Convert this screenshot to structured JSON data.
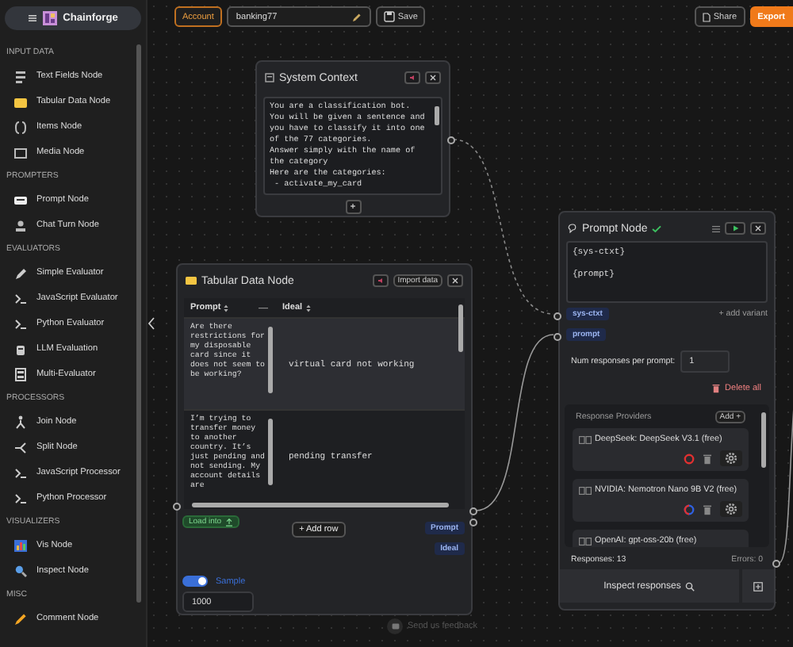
{
  "sidebar": {
    "title": "Chainforge",
    "sections": [
      {
        "title": "INPUT DATA",
        "items": [
          {
            "label": "Text Fields Node"
          },
          {
            "label": "Tabular Data Node"
          },
          {
            "label": "Items Node"
          },
          {
            "label": "Media Node"
          }
        ]
      },
      {
        "title": "PROMPTERS",
        "items": [
          {
            "label": "Prompt Node"
          },
          {
            "label": "Chat Turn Node"
          }
        ]
      },
      {
        "title": "EVALUATORS",
        "items": [
          {
            "label": "Simple Evaluator"
          },
          {
            "label": "JavaScript Evaluator"
          },
          {
            "label": "Python Evaluator"
          },
          {
            "label": "LLM Evaluation"
          },
          {
            "label": "Multi-Evaluator"
          }
        ]
      },
      {
        "title": "PROCESSORS",
        "items": [
          {
            "label": "Join Node"
          },
          {
            "label": "Split Node"
          },
          {
            "label": "JavaScript Processor"
          },
          {
            "label": "Python Processor"
          }
        ]
      },
      {
        "title": "VISUALIZERS",
        "items": [
          {
            "label": "Vis Node"
          },
          {
            "label": "Inspect Node"
          }
        ]
      },
      {
        "title": "MISC",
        "items": [
          {
            "label": "Comment Node"
          }
        ]
      }
    ]
  },
  "toolbar": {
    "account": "Account",
    "flow_name": "banking77",
    "save": "Save",
    "share": "Share",
    "export": "Export"
  },
  "system_context": {
    "title": "System Context",
    "text": "You are a classification bot.\nYou will be given a sentence and\nyou have to classify it into one\nof the 77 categories.\nAnswer simply with the name of\nthe category\nHere are the categories:\n - activate_my_card",
    "add": "+"
  },
  "tabular_node": {
    "title": "Tabular Data Node",
    "import": "Import data",
    "columns": [
      {
        "label": "Prompt"
      },
      {
        "label": "Ideal"
      }
    ],
    "rows": [
      {
        "prompt": "Are there restrictions for my disposable card since it does not seem to be working?",
        "ideal": "virtual card not working",
        "selected": true
      },
      {
        "prompt": "I’m trying to transfer money to another country. It’s just pending and not sending. My account details are",
        "ideal": "pending transfer",
        "selected": false
      }
    ],
    "load_into": "Load into",
    "add_row": "+ Add row",
    "outputs": [
      "Prompt",
      "Ideal"
    ],
    "sample": {
      "label": "Sample",
      "on": true
    },
    "sample_size": "1000"
  },
  "prompt_node": {
    "title": "Prompt Node",
    "template": "{sys-ctxt}\n\n{prompt}",
    "add_variant": "+ add variant",
    "variables": [
      "sys-ctxt",
      "prompt"
    ],
    "num_label": "Num responses per prompt:",
    "num_value": "1",
    "delete_all": "Delete all",
    "providers_title": "Response Providers",
    "add": "Add +",
    "providers": [
      {
        "name": "DeepSeek: DeepSeek V3.1 (free)"
      },
      {
        "name": "NVIDIA: Nemotron Nano 9B V2 (free)"
      },
      {
        "name": "OpenAI: gpt-oss-20b (free)"
      }
    ],
    "responses": "Responses: 13",
    "errors": "Errors: 0",
    "inspect": "Inspect responses"
  },
  "feedback": "Send us feedback"
}
